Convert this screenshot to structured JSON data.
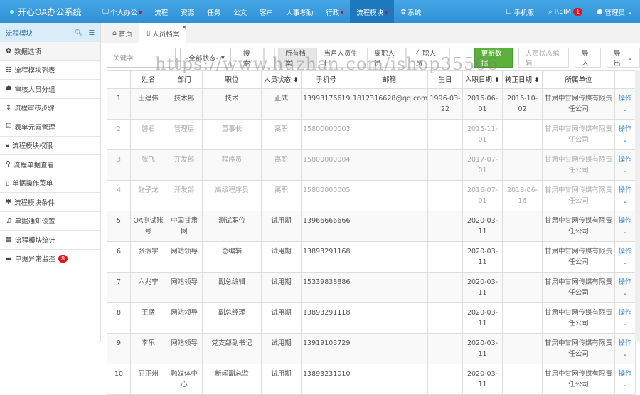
{
  "header": {
    "logo": "开心OA办公系统",
    "nav": [
      {
        "label": "个人办公",
        "dot": true
      },
      {
        "label": "流程"
      },
      {
        "label": "资源"
      },
      {
        "label": "任务"
      },
      {
        "label": "公文"
      },
      {
        "label": "客户"
      },
      {
        "label": "人事考勤"
      },
      {
        "label": "行政",
        "dot": true
      },
      {
        "label": "流程模块",
        "dot": true,
        "active": true
      },
      {
        "label": "系统",
        "icon": "gear-icon"
      }
    ],
    "mobile": "手机版",
    "reim": "REIM",
    "reim_badge": "1",
    "user": "管理员"
  },
  "sidebar": {
    "title": "流程模块",
    "items": [
      {
        "label": "数据选项",
        "icon": "gear-icon"
      },
      {
        "label": "流程模块列表",
        "icon": "list-icon"
      },
      {
        "label": "审核人员分组",
        "icon": "users-icon"
      },
      {
        "label": "流程审核步骤",
        "icon": "step-icon"
      },
      {
        "label": "表单元素管理",
        "icon": "checkbox-icon"
      },
      {
        "label": "流程模块权限",
        "icon": "lock-icon"
      },
      {
        "label": "流程单据查看",
        "icon": "search-icon"
      },
      {
        "label": "单据操作菜单",
        "icon": "bookmark-icon"
      },
      {
        "label": "流程模块条件",
        "icon": "asterisk-icon"
      },
      {
        "label": "单据通知设置",
        "icon": "bell-icon"
      },
      {
        "label": "流程模块统计",
        "icon": "chart-icon"
      },
      {
        "label": "单据异常监控",
        "icon": "briefcase-icon",
        "badge": "8"
      }
    ]
  },
  "tabs": [
    {
      "label": "首页"
    },
    {
      "label": "人员档案",
      "active": true
    }
  ],
  "toolbar": {
    "keyword_placeholder": "关键字",
    "status_select": "-全部状态-",
    "search": "搜索",
    "filters": [
      "所有档案",
      "当月人员生日",
      "离职人员",
      "在职人员"
    ],
    "refresh": "更新数据",
    "edit_status": "人员状态编辑",
    "import": "导入",
    "export": "导出"
  },
  "watermark": "https://www.huzhan.com/ishop35506",
  "table": {
    "headers": [
      "",
      "姓名",
      "部门",
      "职位",
      "人员状态 ⬍",
      "手机号",
      "邮箱",
      "生日",
      "入职日期 ⬍",
      "转正日期 ⬍",
      "所属单位",
      ""
    ],
    "action": "操作⌄",
    "rows": [
      [
        "1",
        "王建伟",
        "技术部",
        "技术",
        "正式",
        "13993176619",
        "1812316628@qq.com",
        "1996-03-22",
        "2016-06-01",
        "2016-10-02",
        "甘肃中甘网传媒有限责任公司"
      ],
      [
        "2",
        "磐石",
        "管理层",
        "董事长",
        "离职",
        "15800000003",
        "",
        "",
        "2015-11-01",
        "",
        "甘肃中甘网传媒有限责任公司"
      ],
      [
        "3",
        "张飞",
        "开发部",
        "程序员",
        "离职",
        "15800000004",
        "",
        "",
        "2017-07-01",
        "",
        "甘肃中甘网传媒有限责任公司"
      ],
      [
        "4",
        "赵子龙",
        "开发部",
        "高级程序员",
        "离职",
        "15800000005",
        "",
        "",
        "2016-07-01",
        "2018-06-16",
        "甘肃中甘网传媒有限责任公司"
      ],
      [
        "5",
        "OA测试账号",
        "中国甘肃网",
        "测试职位",
        "试用期",
        "13966666666",
        "",
        "",
        "2020-03-11",
        "",
        "甘肃中甘网传媒有限责任公司"
      ],
      [
        "6",
        "张振宇",
        "网站领导",
        "总编辑",
        "试用期",
        "13893291168",
        "",
        "",
        "2020-03-11",
        "",
        "甘肃中甘网传媒有限责任公司"
      ],
      [
        "7",
        "六兆宁",
        "网站领导",
        "副总编辑",
        "试用期",
        "15339838886",
        "",
        "",
        "2020-03-11",
        "",
        "甘肃中甘网传媒有限责任公司"
      ],
      [
        "8",
        "王猛",
        "网站领导",
        "副总经理",
        "试用期",
        "13893291118",
        "",
        "",
        "2020-03-11",
        "",
        "甘肃中甘网传媒有限责任公司"
      ],
      [
        "9",
        "李乐",
        "网站领导",
        "党支部副书记",
        "试用期",
        "13919103729",
        "",
        "",
        "2020-03-11",
        "",
        "甘肃中甘网传媒有限责任公司"
      ],
      [
        "10",
        "屈正州",
        "融媒体中心",
        "新闻副总监",
        "试用期",
        "13893231010",
        "",
        "",
        "2020-03-11",
        "",
        "甘肃中甘网传媒有限责任公司"
      ]
    ]
  }
}
